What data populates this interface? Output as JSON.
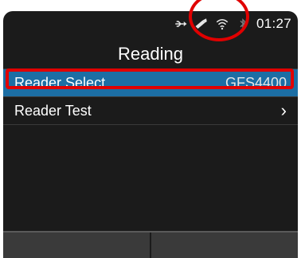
{
  "status": {
    "time": "01:27",
    "icons": [
      "usb-icon",
      "scanner-icon",
      "wifi-icon",
      "bluetooth-icon"
    ]
  },
  "screen": {
    "title": "Reading"
  },
  "menu": {
    "items": [
      {
        "label": "Reader Select",
        "value": "GFS4400",
        "selected": true
      },
      {
        "label": "Reader Test",
        "value": "",
        "chevron": "›",
        "selected": false
      }
    ]
  },
  "colors": {
    "background": "#1b1b1b",
    "selection": "#1c6ea4",
    "annotation": "#e00000"
  }
}
